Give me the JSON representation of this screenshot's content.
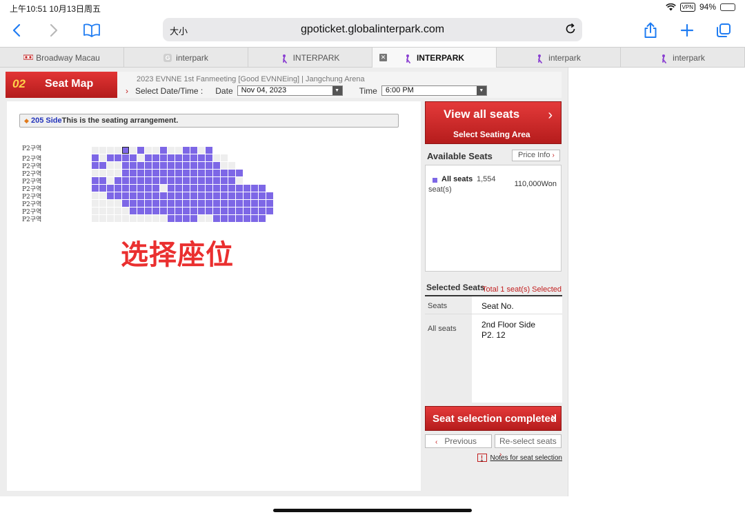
{
  "status": {
    "time": "上午10:51  10月13日周五",
    "vpn": "VPN",
    "battery": "94%",
    "battery_level": 0.94
  },
  "browser": {
    "text_size": "大小",
    "url": "gpoticket.globalinterpark.com"
  },
  "tabs": [
    {
      "label": "Broadway Macau",
      "favicon": "broadway-favicon"
    },
    {
      "label": "interpark",
      "favicon": "g-favicon"
    },
    {
      "label": "INTERPARK",
      "favicon": "interpark-favicon"
    },
    {
      "label": "INTERPARK",
      "favicon": "interpark-favicon",
      "active": true
    },
    {
      "label": "interpark",
      "favicon": "interpark-favicon"
    },
    {
      "label": "interpark",
      "favicon": "interpark-favicon"
    }
  ],
  "step": {
    "number": "02",
    "title": "Seat Map",
    "event": "2023 EVNNE 1st Fanmeeting  [Good EVNNEing]       |      Jangchung Arena",
    "select_label": "Select Date/Time :",
    "date_label": "Date",
    "date_value": "Nov 04, 2023",
    "time_label": "Time",
    "time_value": "6:00 PM"
  },
  "notice": {
    "section": "205 Side",
    "text": "This is the seating arrangement."
  },
  "row_labels": [
    "P2구역",
    "P2구역",
    "P2구역",
    "P2구역",
    "P2구역",
    "P2구역",
    "P2구역",
    "P2구역",
    "P2구역",
    "P2구역"
  ],
  "seat_rows": [
    "uuuusuauuauuaaua",
    "auaaaauaaaaaaaaauu",
    "aauuaaaaaaaaaaaaauu",
    "uuuuaaaaaaaaaaaaaaaa",
    "aauaaaaaaaaaaaaaaaau",
    "aaaaaaaaauaaaaaaaaaaaaa",
    "uuaaaaaaaaaaaaaaaaaaaaaa",
    "uuuuaaaaaaaaaaaaaaaaaaaa",
    "uuuuuaaaaaaaaaaaaaaaaaaa",
    "uuuuuuuuuuaaaauuaaaaaaa"
  ],
  "overlay_text": "选择座位",
  "right": {
    "view_all": "View all seats",
    "select_area": "Select Seating Area",
    "available_title": "Available Seats",
    "price_info": "Price Info",
    "seat_name": "All seats",
    "seat_count": "1,554",
    "seat_unit": "seat(s)",
    "seat_price": "110,000Won",
    "selected_title": "Selected Seats",
    "selected_total": "Total 1 seat(s) Selected",
    "col_seats": "Seats",
    "col_seatno": "Seat No.",
    "row_grade": "All seats",
    "row_floor": "2nd Floor Side",
    "row_seat": "P2. 12",
    "complete": "Seat selection completed",
    "previous": "Previous",
    "reselect": "Re-select seats",
    "notes": "Notes for seat selection"
  },
  "colors": {
    "accent_red": "#c21d1d",
    "seat_available": "#7d67e6",
    "link_blue": "#1f7cf2"
  }
}
